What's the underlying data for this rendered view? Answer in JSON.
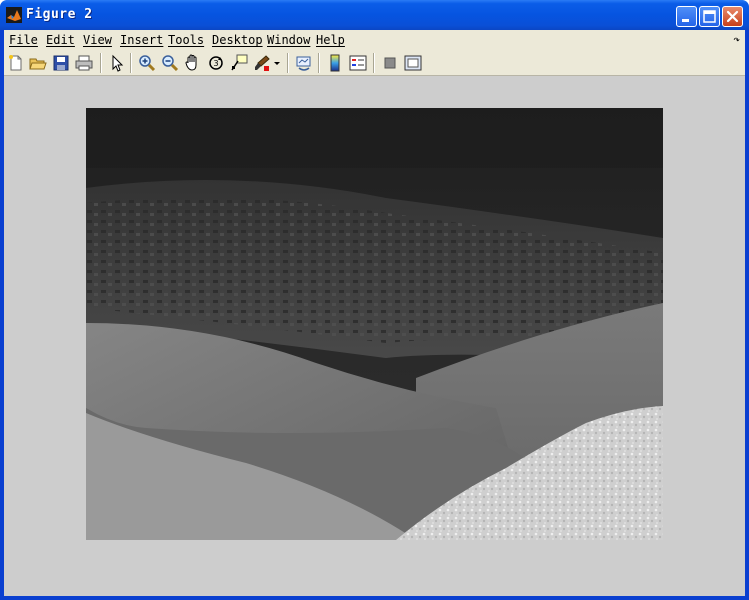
{
  "window": {
    "title": "Figure 2"
  },
  "menubar": {
    "items": [
      "File",
      "Edit",
      "View",
      "Insert",
      "Tools",
      "Desktop",
      "Window",
      "Help"
    ],
    "overflow_icon": "dock-arrow-icon"
  },
  "toolbar": {
    "buttons": [
      {
        "name": "new-figure",
        "icon": "new-file-icon"
      },
      {
        "name": "open-file",
        "icon": "folder-open-icon"
      },
      {
        "name": "save-figure",
        "icon": "save-icon"
      },
      {
        "name": "print-figure",
        "icon": "printer-icon"
      },
      {
        "name": "edit-plot",
        "icon": "arrow-pointer-icon"
      },
      {
        "name": "zoom-in",
        "icon": "zoom-in-icon"
      },
      {
        "name": "zoom-out",
        "icon": "zoom-out-icon"
      },
      {
        "name": "pan",
        "icon": "hand-icon"
      },
      {
        "name": "rotate-3d",
        "icon": "rotate-icon"
      },
      {
        "name": "data-cursor",
        "icon": "data-cursor-icon"
      },
      {
        "name": "brush",
        "icon": "brush-icon"
      },
      {
        "name": "link-plot",
        "icon": "link-icon"
      },
      {
        "name": "insert-colorbar",
        "icon": "colorbar-icon"
      },
      {
        "name": "insert-legend",
        "icon": "legend-icon"
      },
      {
        "name": "hide-plot-tools",
        "icon": "hide-tools-icon"
      },
      {
        "name": "show-plot-tools",
        "icon": "show-tools-icon"
      }
    ]
  },
  "figure": {
    "background": "#cdcdcd",
    "image_description_colors": {
      "sky": "#2a2a2a",
      "hills": "#5a5a5a",
      "foreground": "#c9c9c9"
    }
  }
}
